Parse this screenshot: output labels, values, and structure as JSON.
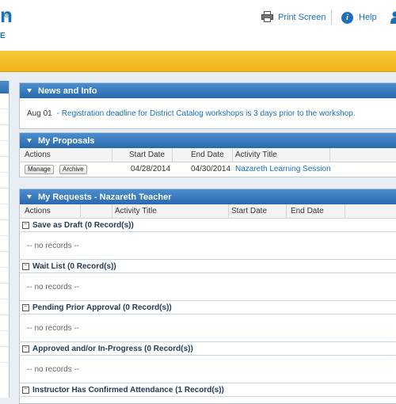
{
  "header": {
    "logo_fragment": "n",
    "logo_reg": "®",
    "logo_sub": "E",
    "print_label": "Print Screen",
    "help_label": "Help",
    "brand_color": "#1b6fb5",
    "banner_color": "#f5bf2a"
  },
  "news": {
    "title": "News and Info",
    "items": [
      {
        "date": "Aug 01",
        "text": "- Registration deadline for District Catalog workshops is 3 days prior to the workshop."
      }
    ]
  },
  "proposals": {
    "title": "My Proposals",
    "columns": [
      "Actions",
      "Start Date",
      "End Date",
      "Activity Title"
    ],
    "rows": [
      {
        "buttons": [
          "Manage",
          "Archive"
        ],
        "start_date": "04/28/2014",
        "end_date": "04/30/2014",
        "activity_title": "Nazareth Learning Session"
      }
    ]
  },
  "requests": {
    "title": "My Requests - Nazareth Teacher",
    "columns": [
      "Actions",
      "Activity Title",
      "Start Date",
      "End Date"
    ],
    "groups": [
      {
        "label": "Save as Draft (0 Record(s))",
        "empty_text": "-- no records --"
      },
      {
        "label": "Wait List (0 Record(s))",
        "empty_text": "-- no records --"
      },
      {
        "label": "Pending Prior Approval (0 Record(s))",
        "empty_text": "-- no records --"
      },
      {
        "label": "Approved and/or In-Progress (0 Record(s))",
        "empty_text": "-- no records --"
      },
      {
        "label": "Instructor Has Confirmed Attendance (1 Record(s))"
      }
    ],
    "toggle_symbol": "−"
  }
}
